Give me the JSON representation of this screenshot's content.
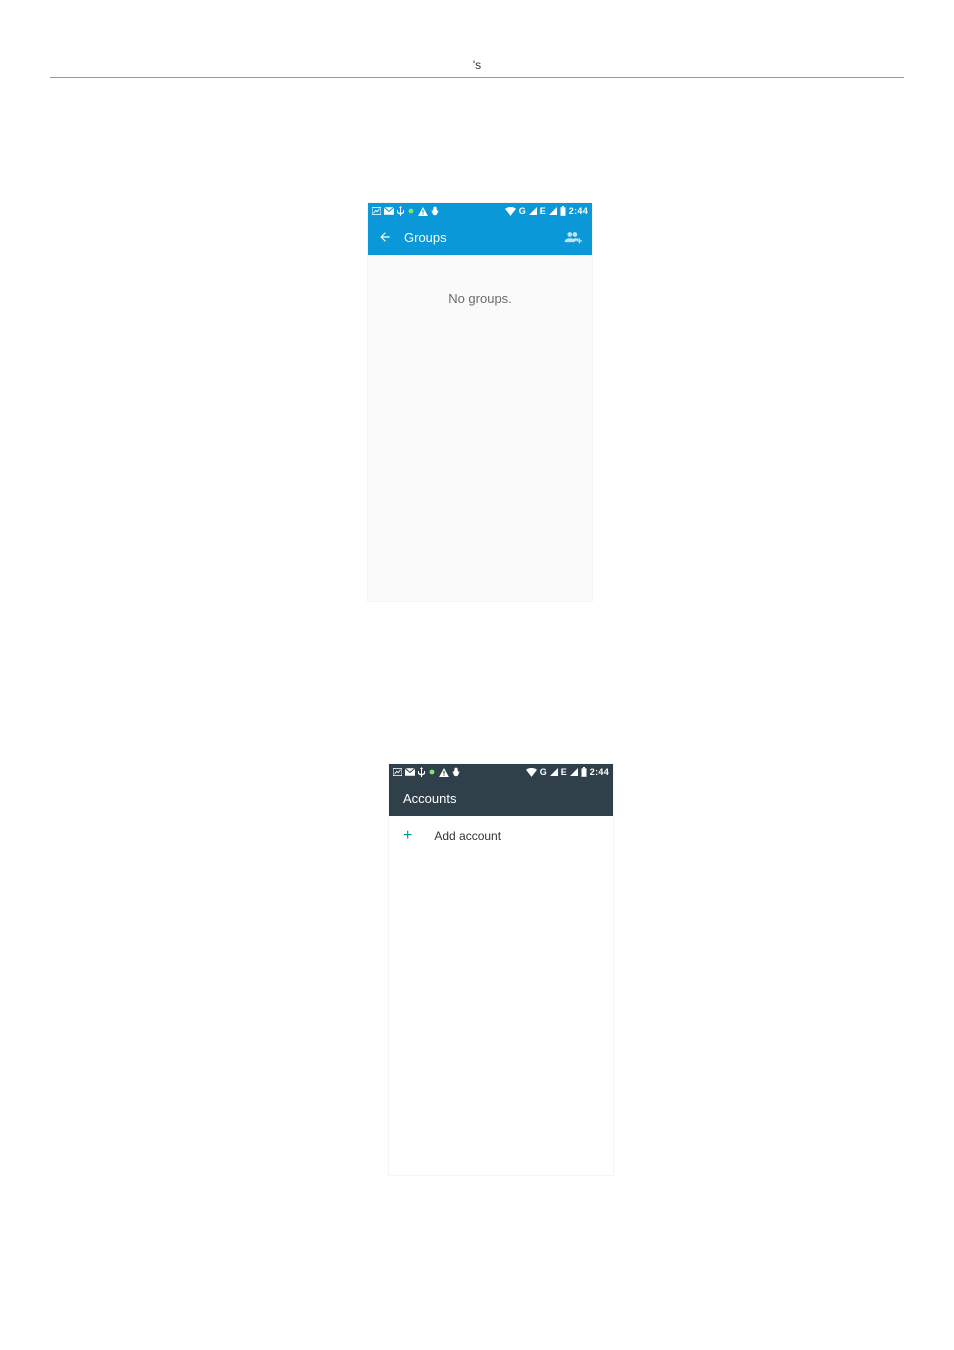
{
  "doc": {
    "header_marker": "'s"
  },
  "screens": {
    "groups": {
      "statusbar": {
        "time": "2:44",
        "signal_label_1": "G",
        "signal_label_2": "E"
      },
      "appbar": {
        "title": "Groups",
        "back_icon": "arrow-left-icon",
        "action_icon": "add-group-icon"
      },
      "body": {
        "empty_message": "No groups."
      }
    },
    "accounts": {
      "statusbar": {
        "time": "2:44",
        "signal_label_1": "G",
        "signal_label_2": "E"
      },
      "appbar": {
        "title": "Accounts"
      },
      "body": {
        "add_account_label": "Add account",
        "add_icon_glyph": "+"
      }
    }
  },
  "colors": {
    "blue": "#0a98d8",
    "dark": "#30404b",
    "teal": "#009688"
  }
}
